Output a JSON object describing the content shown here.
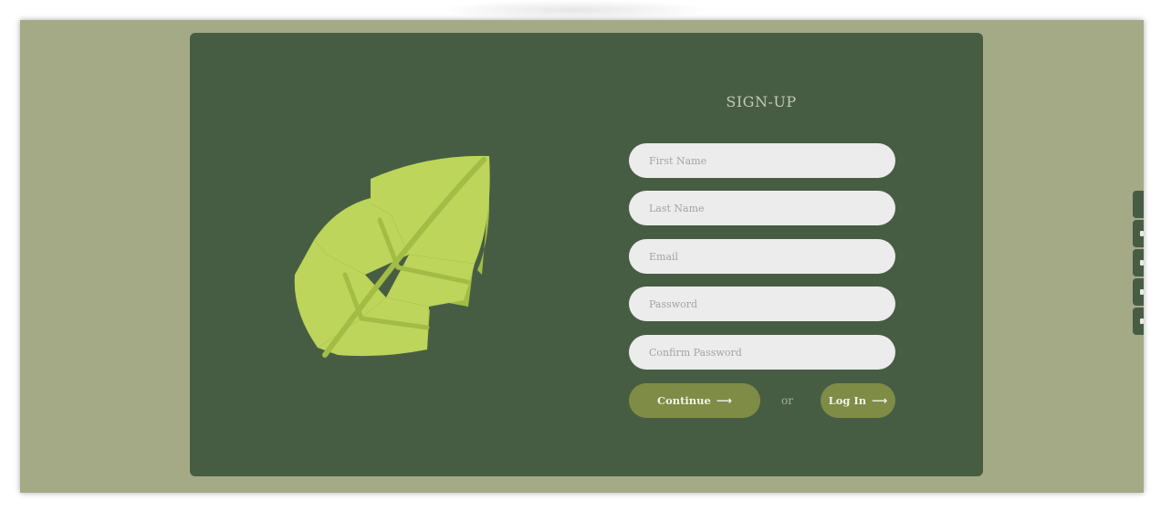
{
  "form": {
    "title": "SIGN-UP",
    "fields": [
      {
        "placeholder": "First Name"
      },
      {
        "placeholder": "Last Name"
      },
      {
        "placeholder": "Email"
      },
      {
        "placeholder": "Password"
      },
      {
        "placeholder": "Confirm Password"
      }
    ],
    "continue_label": "Continue",
    "or_label": "or",
    "login_label": "Log In"
  },
  "icons": {
    "brand": "leaf-icon",
    "continue": "arrow-right-icon",
    "login": "arrow-right-icon",
    "side_tabs": [
      "side-tab-icon",
      "side-tab-icon",
      "side-tab-icon",
      "side-tab-icon",
      "side-tab-icon"
    ]
  },
  "colors": {
    "page_background": "#a4aa86",
    "card_background": "#475d43",
    "leaf_light": "#bcd55a",
    "leaf_shadow": "#a2bc45",
    "button": "#7e8c45",
    "input_background": "#ececec"
  }
}
